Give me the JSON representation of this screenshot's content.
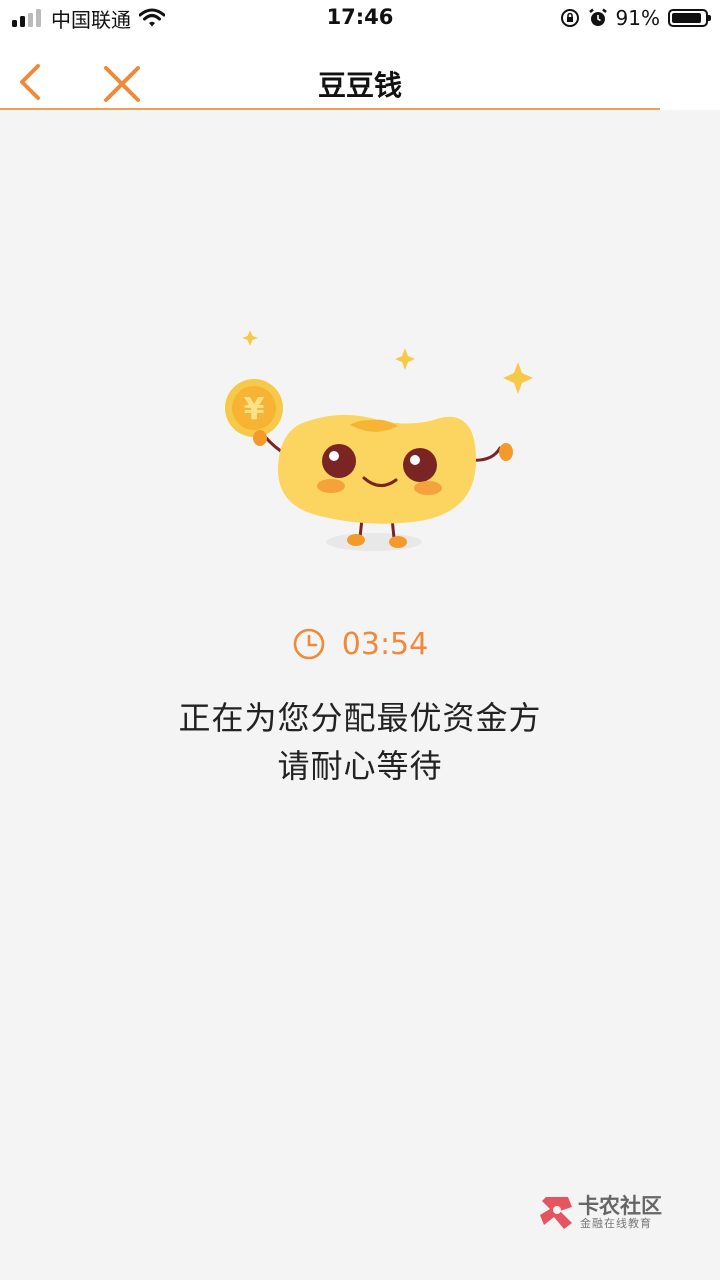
{
  "status_bar": {
    "carrier": "中国联通",
    "time": "17:46",
    "battery": "91%",
    "battery_level": 0.91,
    "icons": [
      "signal-icon",
      "wifi-icon",
      "rotation-lock-icon",
      "alarm-icon",
      "battery-icon"
    ]
  },
  "nav": {
    "title": "豆豆钱",
    "back_icon": "chevron-left-icon",
    "close_icon": "close-icon",
    "accent_color": "#ef8a3a"
  },
  "content": {
    "illustration": "bean-mascot-holding-yuan-coin",
    "timer_icon": "clock-icon",
    "countdown": "03:54",
    "message_line1": "正在为您分配最优资金方",
    "message_line2": "请耐心等待"
  },
  "watermark": {
    "name": "卡农社区",
    "tagline": "金融在线教育",
    "coin_symbol": "¥"
  }
}
